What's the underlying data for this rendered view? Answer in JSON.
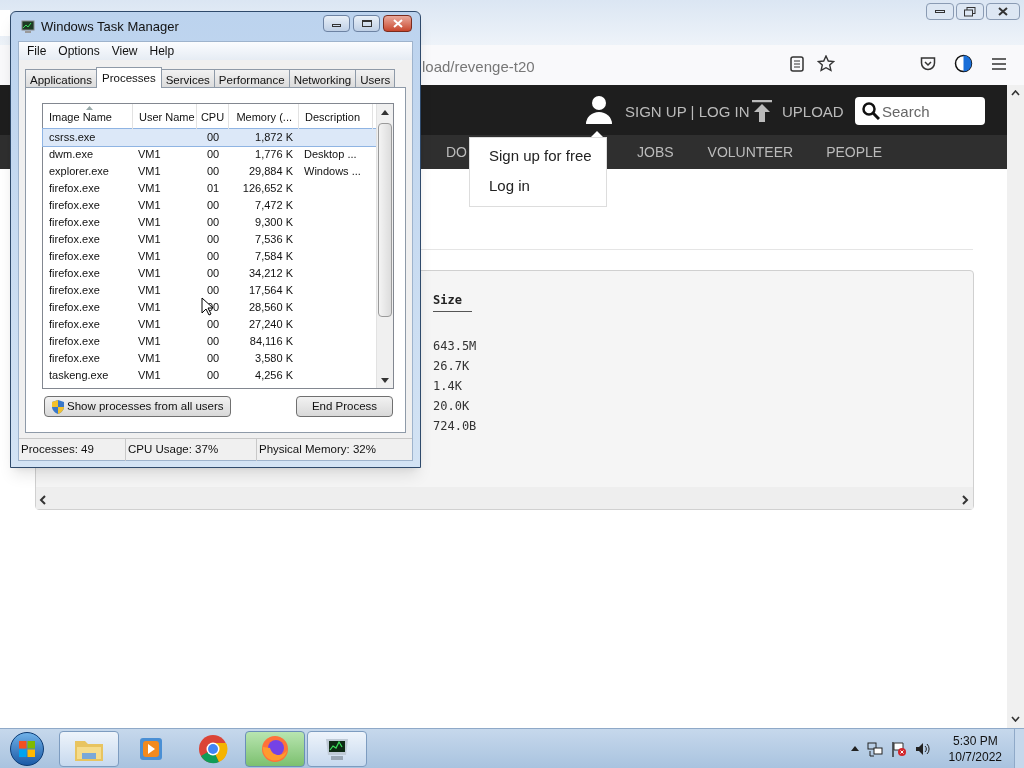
{
  "browser": {
    "address": "load/revenge-t20",
    "site_header": {
      "account_link": "SIGN UP | LOG IN",
      "upload_link": "UPLOAD",
      "search": {
        "placeholder": "Search"
      }
    },
    "nav": [
      {
        "label": "DO"
      },
      {
        "label": "JOBS"
      },
      {
        "label": "VOLUNTEER"
      },
      {
        "label": "PEOPLE"
      }
    ],
    "account_menu": [
      {
        "label": "Sign up for free"
      },
      {
        "label": "Log in"
      }
    ],
    "file_panel": {
      "column": "Size",
      "sizes": [
        "643.5M",
        "26.7K",
        "1.4K",
        "20.0K",
        "724.0B"
      ]
    }
  },
  "task_manager": {
    "title": "Windows Task Manager",
    "menu": [
      "File",
      "Options",
      "View",
      "Help"
    ],
    "tabs": [
      {
        "label": "Applications",
        "selected": false
      },
      {
        "label": "Processes",
        "selected": true
      },
      {
        "label": "Services",
        "selected": false
      },
      {
        "label": "Performance",
        "selected": false
      },
      {
        "label": "Networking",
        "selected": false
      },
      {
        "label": "Users",
        "selected": false
      }
    ],
    "columns": [
      "Image Name",
      "User Name",
      "CPU",
      "Memory (...",
      "Description"
    ],
    "rows": [
      {
        "cells": [
          "csrss.exe",
          "",
          "00",
          "1,872 K",
          ""
        ],
        "selected": true
      },
      {
        "cells": [
          "dwm.exe",
          "VM1",
          "00",
          "1,776 K",
          "Desktop ..."
        ],
        "selected": false
      },
      {
        "cells": [
          "explorer.exe",
          "VM1",
          "00",
          "29,884 K",
          "Windows ..."
        ],
        "selected": false
      },
      {
        "cells": [
          "firefox.exe",
          "VM1",
          "01",
          "126,652 K",
          ""
        ],
        "selected": false
      },
      {
        "cells": [
          "firefox.exe",
          "VM1",
          "00",
          "7,472 K",
          ""
        ],
        "selected": false
      },
      {
        "cells": [
          "firefox.exe",
          "VM1",
          "00",
          "9,300 K",
          ""
        ],
        "selected": false
      },
      {
        "cells": [
          "firefox.exe",
          "VM1",
          "00",
          "7,536 K",
          ""
        ],
        "selected": false
      },
      {
        "cells": [
          "firefox.exe",
          "VM1",
          "00",
          "7,584 K",
          ""
        ],
        "selected": false
      },
      {
        "cells": [
          "firefox.exe",
          "VM1",
          "00",
          "34,212 K",
          ""
        ],
        "selected": false
      },
      {
        "cells": [
          "firefox.exe",
          "VM1",
          "00",
          "17,564 K",
          ""
        ],
        "selected": false
      },
      {
        "cells": [
          "firefox.exe",
          "VM1",
          "00",
          "28,560 K",
          ""
        ],
        "selected": false
      },
      {
        "cells": [
          "firefox.exe",
          "VM1",
          "00",
          "27,240 K",
          ""
        ],
        "selected": false
      },
      {
        "cells": [
          "firefox.exe",
          "VM1",
          "00",
          "84,116 K",
          ""
        ],
        "selected": false
      },
      {
        "cells": [
          "firefox.exe",
          "VM1",
          "00",
          "3,580 K",
          ""
        ],
        "selected": false
      },
      {
        "cells": [
          "taskeng.exe",
          "VM1",
          "00",
          "4,256 K",
          ""
        ],
        "selected": false
      }
    ],
    "show_all_button": "Show processes from all users",
    "end_button": "End Process",
    "status_bar": [
      "Processes: 49",
      "CPU Usage: 37%",
      "Physical Memory: 32%"
    ]
  },
  "taskbar": {
    "apps": [
      {
        "kind": "folder",
        "running": true
      },
      {
        "kind": "media",
        "running": false
      },
      {
        "kind": "chrome",
        "running": false
      },
      {
        "kind": "firefox",
        "running": true
      },
      {
        "kind": "monitor",
        "running": true
      }
    ],
    "time": "5:30 PM",
    "date": "10/7/2022"
  }
}
